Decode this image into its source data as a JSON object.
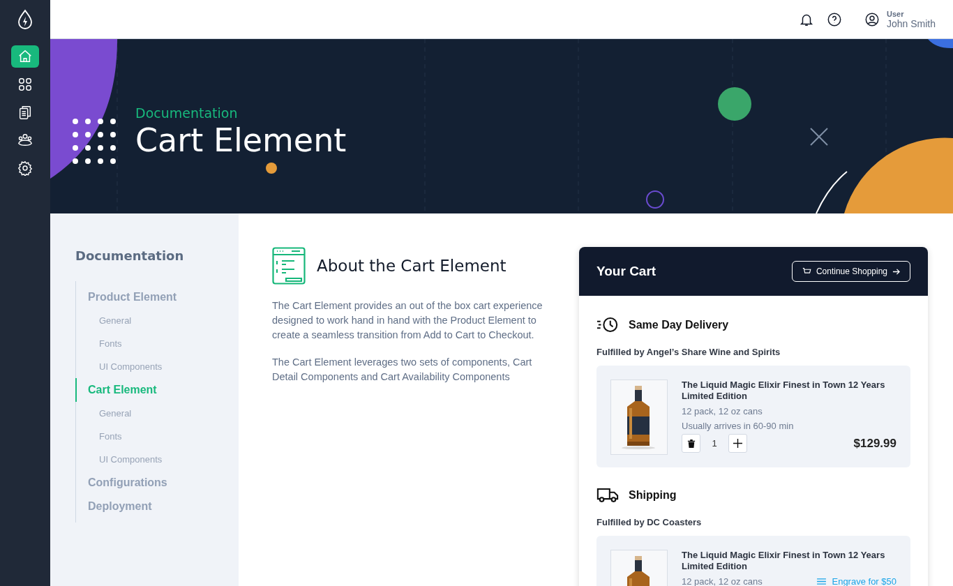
{
  "rail": {
    "items": [
      {
        "kind": "home",
        "selected": true
      },
      {
        "kind": "apps",
        "selected": false
      },
      {
        "kind": "docs",
        "selected": false
      },
      {
        "kind": "team",
        "selected": false
      },
      {
        "kind": "settings",
        "selected": false
      }
    ]
  },
  "topbar": {
    "user_label": "User",
    "user_name": "John Smith"
  },
  "hero": {
    "eyebrow": "Documentation",
    "title": "Cart Element"
  },
  "docs_nav": {
    "title": "Documentation",
    "sections": [
      {
        "label": "Product Element",
        "selected": false,
        "children": [
          {
            "label": "General",
            "selected": false
          },
          {
            "label": "Fonts",
            "selected": false
          },
          {
            "label": "UI Components",
            "selected": false
          }
        ]
      },
      {
        "label": "Cart Element",
        "selected": true,
        "children": [
          {
            "label": "General",
            "selected": false
          },
          {
            "label": "Fonts",
            "selected": false
          },
          {
            "label": "UI Components",
            "selected": false
          }
        ]
      },
      {
        "label": "Configurations",
        "selected": false
      },
      {
        "label": "Deployment",
        "selected": false
      }
    ]
  },
  "article": {
    "heading": "About the Cart Element",
    "paragraphs": [
      "The Cart Element provides an out of the box cart experience designed to work hand in hand with the Product Element to create a seamless transition from Add to Cart to Checkout.",
      "The Cart Element leverages two sets of components, Cart Detail Components and Cart Availability Components"
    ]
  },
  "cart": {
    "title": "Your Cart",
    "continue_button": "Continue Shopping",
    "groups": [
      {
        "kind": "same_day",
        "title": "Same Day Delivery",
        "fulfilled_by": "Fulfilled by Angel’s Share Wine and Spirits",
        "items": [
          {
            "name": "The Liquid Magic Elixir Finest in Town 12 Years Limited Edition",
            "variant": "12 pack, 12 oz cans",
            "eta": "Usually arrives in 60-90 min",
            "quantity": "1",
            "price": "$129.99"
          }
        ]
      },
      {
        "kind": "shipping",
        "title": "Shipping",
        "fulfilled_by": "Fulfilled by DC Coasters",
        "items": [
          {
            "name": "The Liquid Magic Elixir Finest in Town 12 Years Limited Edition",
            "variant": "12 pack, 12 oz cans",
            "action": "Engrave for $50"
          }
        ]
      }
    ]
  }
}
